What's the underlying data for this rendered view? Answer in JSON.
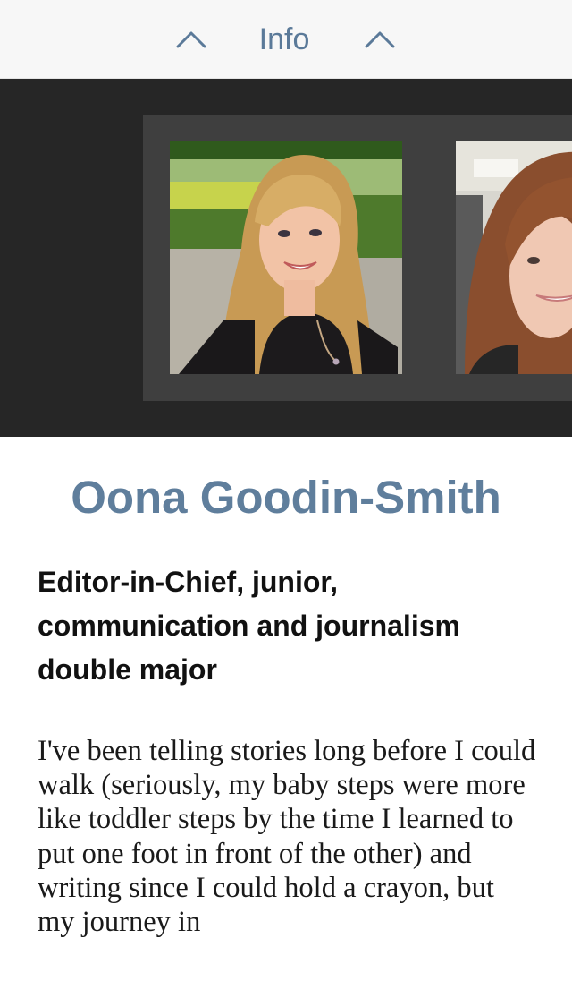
{
  "header": {
    "title": "Info",
    "prev_icon": "chevron-up-icon",
    "next_icon": "chevron-up-icon"
  },
  "carousel": {
    "photos": [
      {
        "alt": "Oona Goodin-Smith"
      },
      {
        "alt": ""
      }
    ]
  },
  "profile": {
    "name": "Oona Goodin-Smith",
    "role": "Editor-in-Chief, junior, communication and journalism double major",
    "bio": "I've been telling stories long before I could walk (seriously, my baby steps were more like toddler steps by the time I learned to put one foot in front of the other) and writing since I could hold a crayon, but my journey in"
  },
  "colors": {
    "accent": "#5f7e9c",
    "header_bg": "#f7f7f7",
    "carousel_bg": "#262626",
    "frame_bg": "#3f3f3f"
  }
}
